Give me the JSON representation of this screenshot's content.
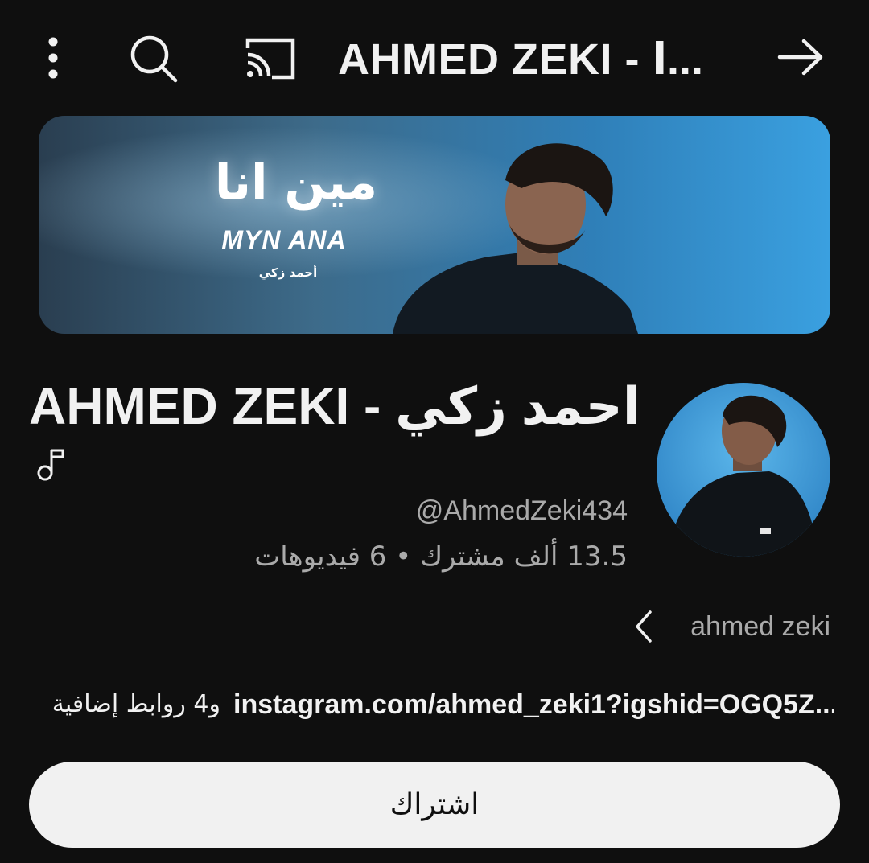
{
  "topbar": {
    "title": "AHMED ZEKI - ا...",
    "icons": [
      "more-vert-icon",
      "search-icon",
      "cast-icon",
      "forward-arrow-icon"
    ]
  },
  "banner": {
    "title_ar": "مين انا",
    "title_en": "MYN ANA",
    "subtitle_ar": "أحمد زكي"
  },
  "channel": {
    "name": "AHMED ZEKI - احمد زكي",
    "handle": "@AhmedZeki434",
    "stats": "13.5 ألف مشترك • 6 فيديوهات",
    "description": "ahmed zeki"
  },
  "links": {
    "primary": "instagram.com/ahmed_zeki1?igshid=OGQ5Z...",
    "more": "و4 روابط إضافية"
  },
  "subscribe": {
    "label": "اشتراك"
  },
  "colors": {
    "background": "#0f0f0f",
    "text_primary": "#f1f1f1",
    "text_secondary": "#aaaaaa",
    "button_bg": "#f1f1f1",
    "banner_accent": "#2f8ecf"
  }
}
